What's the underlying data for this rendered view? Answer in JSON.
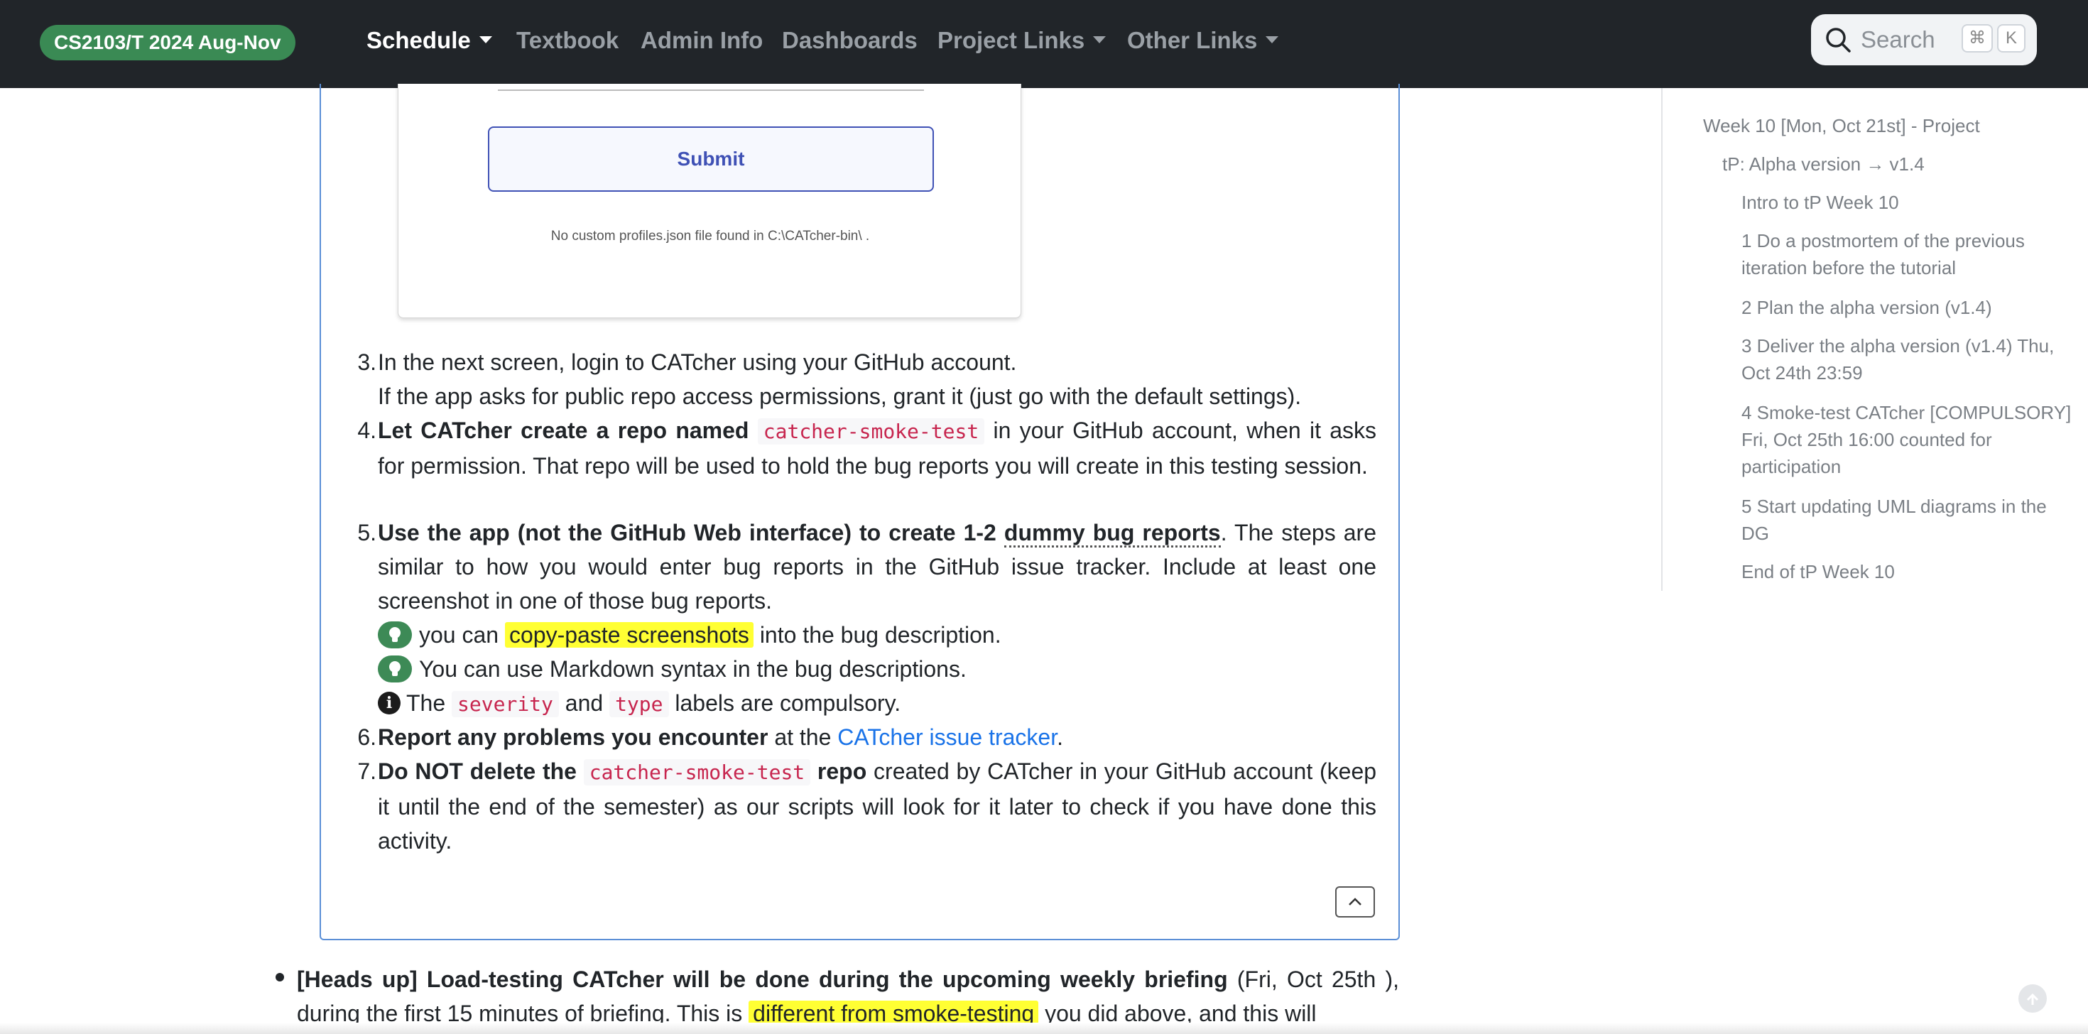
{
  "navbar": {
    "brand": "CS2103/T 2024 Aug-Nov",
    "items": [
      "Schedule",
      "Textbook",
      "Admin Info",
      "Dashboards",
      "Project Links",
      "Other Links"
    ],
    "search": {
      "label": "Search",
      "keys": [
        "⌘",
        "K"
      ]
    }
  },
  "screenshot_card": {
    "submit": "Submit",
    "note": "No custom profiles.json file found in C:\\CATcher-bin\\ ."
  },
  "steps": {
    "s3": {
      "num": "3.",
      "line1": "In the next screen, login to CATcher using your GitHub account.",
      "line2": "If the app asks for public repo access permissions, grant it (just go with the default settings)."
    },
    "s4": {
      "num": "4.",
      "bold": "Let CATcher create a repo named",
      "code": "catcher-smoke-test",
      "rest": "in your GitHub account, when it asks for permission. That repo will be used to hold the bug reports you will create in this testing session."
    },
    "s5": {
      "num": "5.",
      "bold": "Use the app (not the GitHub Web interface) to create 1-2",
      "bold_dotted": "dummy bug reports",
      "rest": ". The steps are similar to how you would enter bug reports in the GitHub issue tracker. Include at least one screenshot in one of those bug reports.",
      "tip1_pre": "you can",
      "tip1_hl": "copy-paste screenshots",
      "tip1_post": "into the bug description.",
      "tip2": "You can use Markdown syntax in the bug descriptions.",
      "info_pre": "The",
      "info_code1": "severity",
      "info_mid": "and",
      "info_code2": "type",
      "info_post": "labels are compulsory."
    },
    "s6": {
      "num": "6.",
      "bold": "Report any problems you encounter",
      "mid": "at the",
      "link": "CATcher issue tracker",
      "end": "."
    },
    "s7": {
      "num": "7.",
      "bold1": "Do NOT delete the",
      "code": "catcher-smoke-test",
      "bold2": "repo",
      "rest": "created by CATcher in your GitHub account (keep it until the end of the semester) as our scripts will look for it later to check if you have done this activity."
    }
  },
  "bullet": {
    "bold": "[Heads up] Load-testing CATcher will be done during the upcoming weekly briefing",
    "rest1": "(Fri, Oct 25th ), during the first 15 minutes of briefing. This is",
    "hl": "different from smoke-testing",
    "rest2": "you did above, and this will"
  },
  "toc": [
    "Week 10 [Mon, Oct 21st] - Project",
    "tP: Alpha version → v1.4",
    "Intro to tP Week 10",
    "1 Do a postmortem of the previous iteration before the tutorial",
    "2 Plan the alpha version (v1.4)",
    "3 Deliver the alpha version (v1.4) Thu, Oct 24th 23:59",
    "4 Smoke-test CATcher [COMPULSORY] Fri, Oct 25th 16:00 counted for participation",
    "5 Start updating UML diagrams in the DG",
    "End of tP Week 10"
  ],
  "colors": {
    "navbar_bg": "#212529",
    "brand_bg": "#3a8a54",
    "panel_border": "#5b8fd6",
    "link": "#1a73e8",
    "highlight": "#ffff33",
    "code_text": "#c7254e"
  },
  "icons": [
    "search-icon",
    "lightbulb-icon",
    "info-icon",
    "chevron-up-icon",
    "scroll-top-icon"
  ]
}
